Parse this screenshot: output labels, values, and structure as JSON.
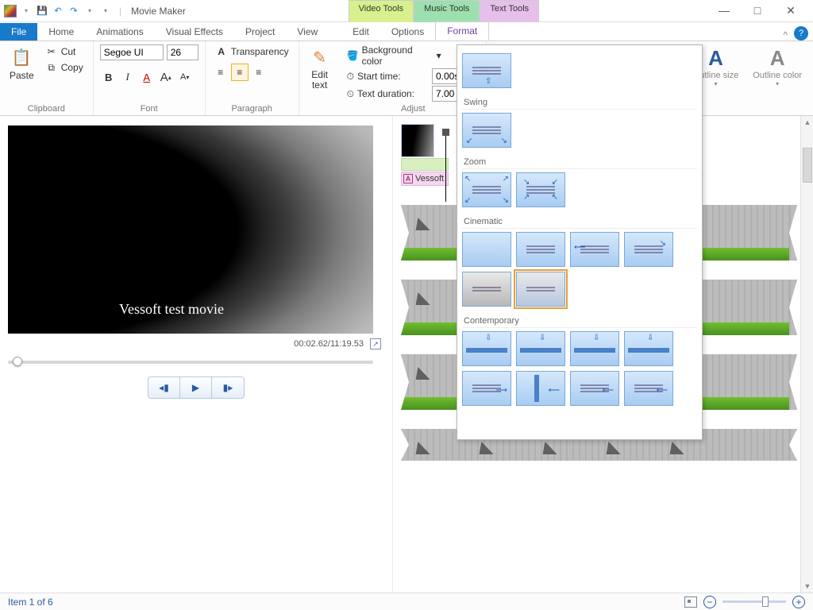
{
  "title": "Movie Maker",
  "qat": {
    "save": "💾",
    "undo": "↶",
    "redo": "↷",
    "more": "▾"
  },
  "window": {
    "min": "—",
    "max": "□",
    "close": "✕"
  },
  "context_tabs": {
    "video": "Video Tools",
    "music": "Music Tools",
    "text": "Text Tools"
  },
  "tabs": {
    "file": "File",
    "home": "Home",
    "animations": "Animations",
    "visual_effects": "Visual Effects",
    "project": "Project",
    "view": "View",
    "edit": "Edit",
    "options": "Options",
    "format": "Format"
  },
  "ribbon": {
    "clipboard": {
      "label": "Clipboard",
      "paste": "Paste",
      "cut": "Cut",
      "copy": "Copy"
    },
    "font": {
      "label": "Font",
      "name": "Segoe UI",
      "size": "26",
      "bold": "B",
      "italic": "I",
      "color": "A",
      "grow": "A",
      "shrink": "A"
    },
    "paragraph": {
      "label": "Paragraph",
      "transparency": "Transparency"
    },
    "edit_text": {
      "label": "Edit\ntext"
    },
    "adjust": {
      "label": "Adjust",
      "bg": "Background color",
      "start": "Start time:",
      "duration": "Text duration:",
      "start_value": "0.00s",
      "duration_value": "7.00"
    },
    "outline": {
      "size": "Outline size",
      "color": "Outline color"
    }
  },
  "gallery": {
    "swing": "Swing",
    "zoom": "Zoom",
    "cinematic": "Cinematic",
    "contemporary": "Contemporary"
  },
  "preview": {
    "overlay_text": "Vessoft test movie",
    "time": "00:02.62/11:19.53"
  },
  "transport": {
    "prev": "◀|",
    "play": "▶",
    "next": "|▶"
  },
  "timeline": {
    "text_label": "Vessoft"
  },
  "status": {
    "item": "Item 1 of 6",
    "zoom_minus": "−",
    "zoom_plus": "+"
  }
}
